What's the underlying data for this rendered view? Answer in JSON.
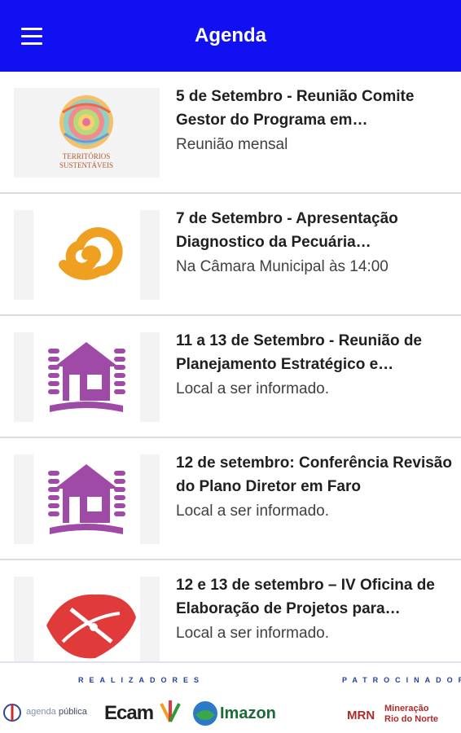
{
  "app": {
    "title": "Agenda"
  },
  "events": [
    {
      "headline": "5 de Setembro - Reunião Comite Gestor do Programa em…",
      "subtitle": "Reunião mensal",
      "logo_text_1": "TERRITÓRIOS",
      "logo_text_2": "SUSTENTÁVEIS"
    },
    {
      "headline": "7 de Setembro - Apresentação Diagnostico da Pecuária…",
      "subtitle": "Na Câmara Municipal às 14:00"
    },
    {
      "headline": "11 a 13 de Setembro - Reunião de Planejamento Estratégico e…",
      "subtitle": "Local a ser informado."
    },
    {
      "headline": "12 de setembro: Conferência Revisão do Plano Diretor em Faro",
      "subtitle": "Local a ser informado."
    },
    {
      "headline": "12 e 13 de setembro – IV Oficina de Elaboração de Projetos para…",
      "subtitle": "Local a ser informado."
    }
  ],
  "footer": {
    "realizadores_label": "REALIZADORES",
    "patrocinador_label": "PATROCINADOR",
    "logos": {
      "agenda_publica_a": "agenda",
      "agenda_publica_b": "pública",
      "ecam": "Ecam",
      "imazon": "Imazon",
      "mrn": "MRN",
      "mineracao_1": "Mineração",
      "mineracao_2": "Rio do Norte"
    }
  },
  "colors": {
    "appbar": "#1010f0",
    "house_icon": "#a04aa8",
    "spiral_icon": "#f0a020",
    "red_icon": "#e03a3a"
  }
}
